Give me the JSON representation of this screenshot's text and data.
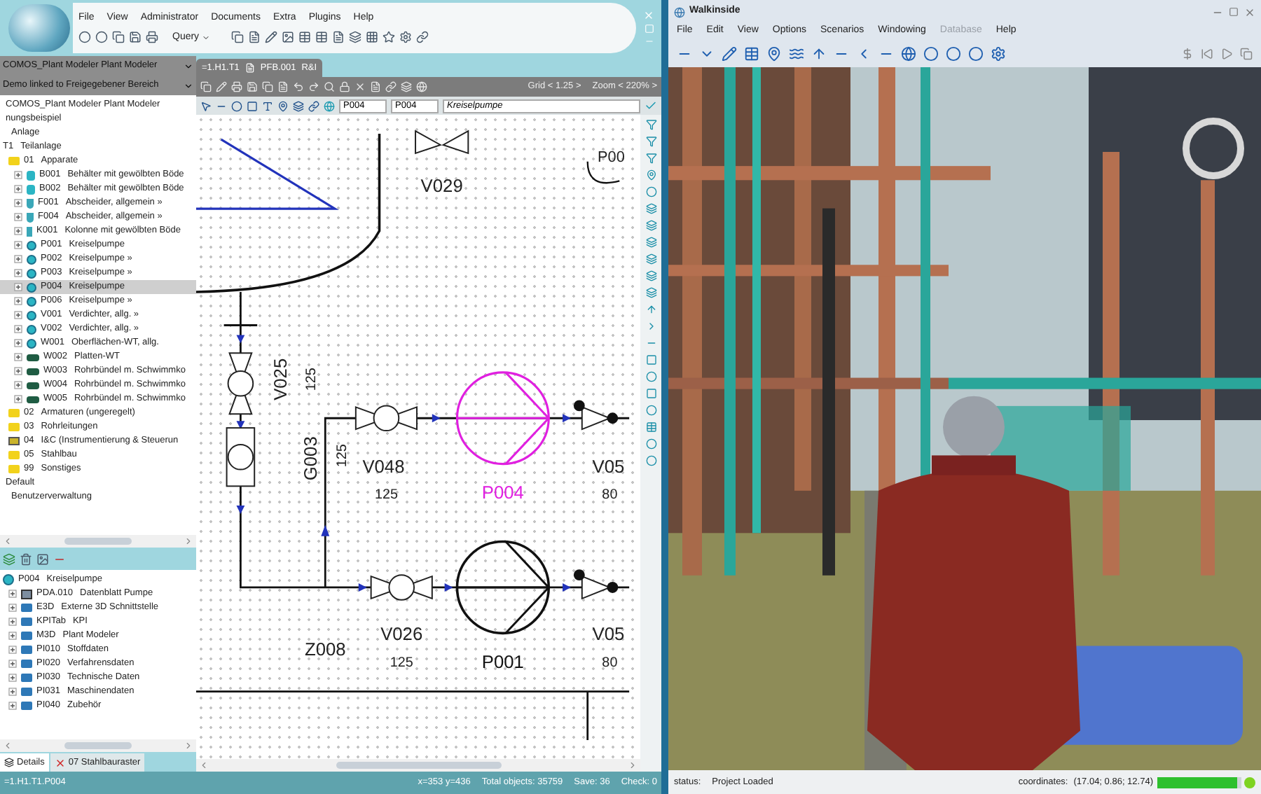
{
  "comos": {
    "menu": [
      "File",
      "View",
      "Administrator",
      "Documents",
      "Extra",
      "Plugins",
      "Help"
    ],
    "query_button": "Query",
    "project_selectors": [
      "COMOS_Plant Modeler  Plant Modeler",
      "Demo  linked to Freigegebener Bereich"
    ],
    "tree": [
      {
        "label": "COMOS_Plant Modeler   Plant Modeler",
        "selected": false
      },
      {
        "label": "nungsbeispiel",
        "selected": false,
        "children": [
          {
            "label": "Anlage",
            "selected": false
          }
        ]
      },
      {
        "code": "T1",
        "label": "Teilanlage",
        "selected": false,
        "children": [
          {
            "code": "01",
            "label": "Apparate",
            "kind": "folder",
            "selected": false,
            "children": [
              {
                "code": "B001",
                "label": "Behälter mit gewölbten Böde",
                "kind": "vessel",
                "selected": false
              },
              {
                "code": "B002",
                "label": "Behälter mit gewölbten Böde",
                "kind": "vessel",
                "selected": false
              },
              {
                "code": "F001",
                "label": "Abscheider, allgemein »",
                "kind": "separator",
                "selected": false
              },
              {
                "code": "F004",
                "label": "Abscheider, allgemein »",
                "kind": "separator",
                "selected": false
              },
              {
                "code": "K001",
                "label": "Kolonne mit gewölbten Böde",
                "kind": "column",
                "selected": false
              },
              {
                "code": "P001",
                "label": "Kreiselpumpe",
                "kind": "pump",
                "selected": false
              },
              {
                "code": "P002",
                "label": "Kreiselpumpe »",
                "kind": "pump",
                "selected": false
              },
              {
                "code": "P003",
                "label": "Kreiselpumpe »",
                "kind": "pump",
                "selected": false
              },
              {
                "code": "P004",
                "label": "Kreiselpumpe",
                "kind": "pump",
                "selected": true
              },
              {
                "code": "P006",
                "label": "Kreiselpumpe »",
                "kind": "pump",
                "selected": false
              },
              {
                "code": "V001",
                "label": "Verdichter, allg. »",
                "kind": "pump",
                "selected": false
              },
              {
                "code": "V002",
                "label": "Verdichter, allg. »",
                "kind": "pump",
                "selected": false
              },
              {
                "code": "W001",
                "label": "Oberflächen-WT, allg.",
                "kind": "pump",
                "selected": false
              },
              {
                "code": "W002",
                "label": "Platten-WT",
                "kind": "exchanger",
                "selected": false
              },
              {
                "code": "W003",
                "label": "Rohrbündel m. Schwimmko",
                "kind": "exchanger",
                "selected": false
              },
              {
                "code": "W004",
                "label": "Rohrbündel m. Schwimmko",
                "kind": "exchanger",
                "selected": false
              },
              {
                "code": "W005",
                "label": "Rohrbündel m. Schwimmko",
                "kind": "exchanger",
                "selected": false
              }
            ]
          },
          {
            "code": "02",
            "label": "Armaturen (ungeregelt)",
            "kind": "folder",
            "selected": false
          },
          {
            "code": "03",
            "label": "Rohrleitungen",
            "kind": "folder",
            "selected": false
          },
          {
            "code": "04",
            "label": "I&C (Instrumentierung & Steuerun",
            "kind": "instrument_folder",
            "selected": false
          },
          {
            "code": "05",
            "label": "Stahlbau",
            "kind": "folder",
            "selected": false
          },
          {
            "code": "99",
            "label": "Sonstiges",
            "kind": "folder",
            "selected": false
          }
        ]
      },
      {
        "label": "Default",
        "selected": false,
        "children": [
          {
            "label": "Benutzerverwaltung",
            "selected": false
          }
        ]
      }
    ],
    "detail_tree": [
      {
        "code": "P004",
        "label": "Kreiselpumpe",
        "kind": "pump_root",
        "selected": false,
        "children": [
          {
            "code": "PDA.010",
            "label": "Datenblatt Pumpe",
            "kind": "datasheet",
            "selected": false
          },
          {
            "code": "E3D",
            "label": "Externe 3D Schnittstelle",
            "kind": "tab",
            "selected": false
          },
          {
            "code": "KPITab",
            "label": "KPI",
            "kind": "tab",
            "selected": false
          },
          {
            "code": "M3D",
            "label": "Plant Modeler",
            "kind": "tab",
            "selected": false
          },
          {
            "code": "PI010",
            "label": "Stoffdaten",
            "kind": "tab",
            "selected": false
          },
          {
            "code": "PI020",
            "label": "Verfahrensdaten",
            "kind": "tab",
            "selected": false
          },
          {
            "code": "PI030",
            "label": "Technische Daten",
            "kind": "tab",
            "selected": false
          },
          {
            "code": "PI031",
            "label": "Maschinendaten",
            "kind": "tab",
            "selected": false
          },
          {
            "code": "PI040",
            "label": "Zubehör",
            "kind": "tab",
            "selected": false
          }
        ]
      }
    ],
    "bottom_tabs": [
      {
        "label": "Details",
        "selected": true
      },
      {
        "label": "07 Stahlbauraster",
        "selected": false
      }
    ],
    "status_path": "=1.H1.T1.P004",
    "document_tab": {
      "path": "=1.H1.T1",
      "document": "PFB.001",
      "type": "R&I"
    },
    "grid": "Grid < 1.25 >",
    "zoom": "Zoom < 220% >",
    "object_fields": [
      "P004",
      "P004",
      "Kreiselpumpe"
    ],
    "diagram": {
      "labels": [
        "V029",
        "P00",
        "V025",
        "125",
        "G003",
        "125",
        "V048",
        "125",
        "V05",
        "80",
        "V026",
        "125",
        "V05",
        "80",
        "Z008"
      ],
      "pumps": [
        {
          "label": "P004",
          "selected": true
        },
        {
          "label": "P001",
          "selected": false
        }
      ]
    },
    "status": [
      "x=353 y=436",
      "Total objects: 35759",
      "Save: 36",
      "Check: 0"
    ]
  },
  "walkinside": {
    "title": "Walkinside",
    "menu": [
      {
        "label": "File",
        "disabled": false
      },
      {
        "label": "Edit",
        "disabled": false
      },
      {
        "label": "View",
        "disabled": false
      },
      {
        "label": "Options",
        "disabled": false
      },
      {
        "label": "Scenarios",
        "disabled": false
      },
      {
        "label": "Windowing",
        "disabled": false
      },
      {
        "label": "Database",
        "disabled": true
      },
      {
        "label": "Help",
        "disabled": false
      }
    ],
    "status_label": "status:",
    "status": "Project Loaded",
    "coordinates_label": "coordinates:",
    "coordinates": "(17.04; 0.86; 12.74)",
    "progress": {
      "level": 0.95
    }
  }
}
